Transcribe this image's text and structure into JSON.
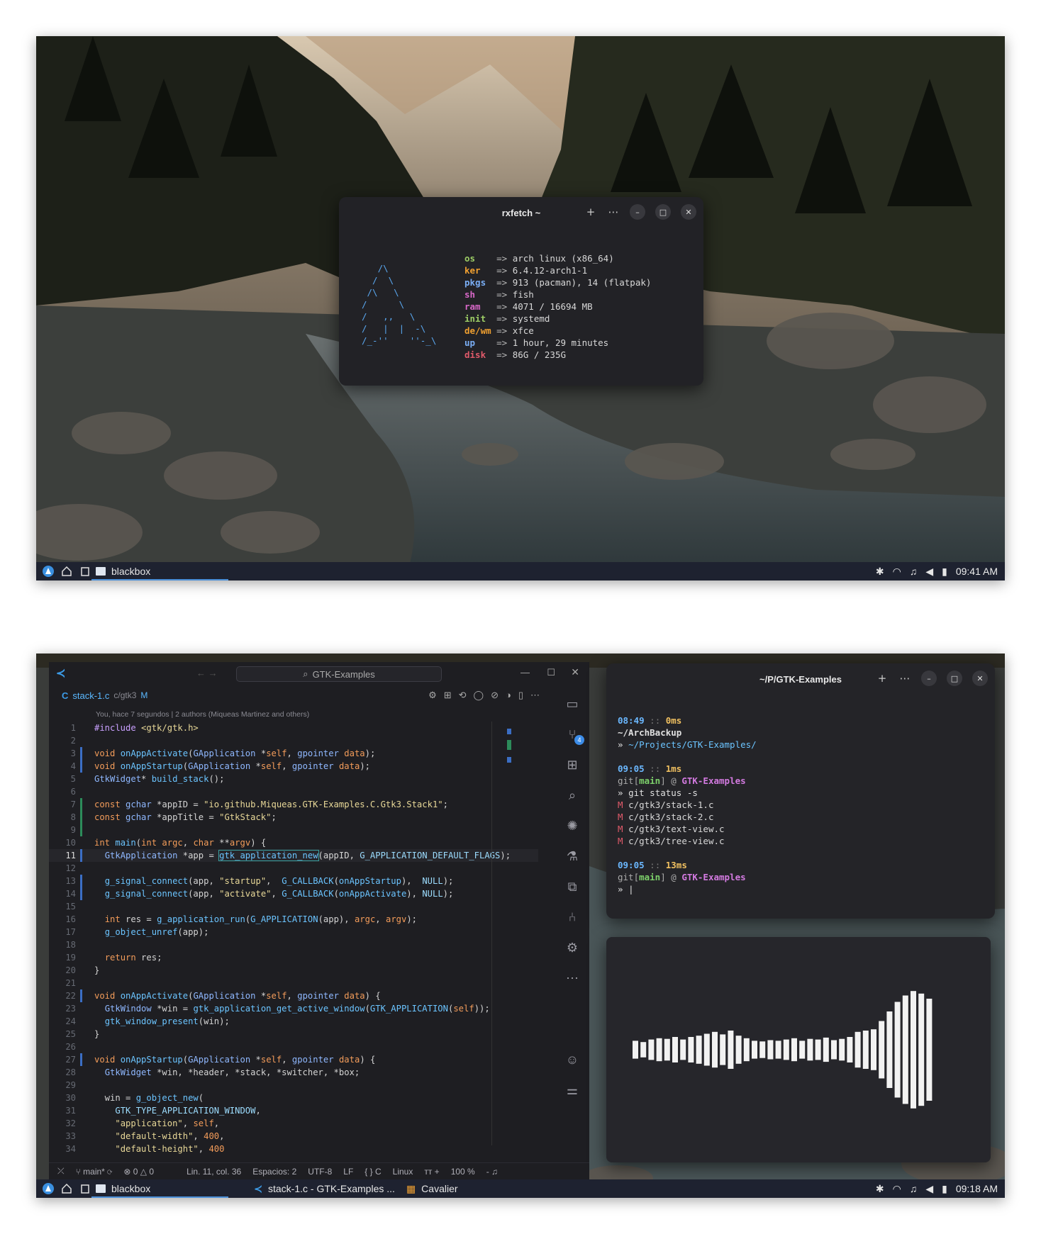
{
  "shot1": {
    "terminal": {
      "title": "rxfetch ~",
      "logo_lines": [
        "   /\\",
        "  /  \\",
        " /\\   \\",
        "/      \\",
        "/   ,,   \\",
        "/   |  |  -\\",
        "/_-''    ''-_\\"
      ],
      "rows": [
        {
          "key": "os",
          "value": "arch linux (x86_64)",
          "color": "#9ccc65"
        },
        {
          "key": "ker",
          "value": "6.4.12-arch1-1",
          "color": "#f0a030"
        },
        {
          "key": "pkgs",
          "value": "913 (pacman), 14 (flatpak)",
          "color": "#7aaef5"
        },
        {
          "key": "sh",
          "value": "fish",
          "color": "#d868c8"
        },
        {
          "key": "ram",
          "value": "4071 / 16694 MB",
          "color": "#d868c8"
        },
        {
          "key": "init",
          "value": "systemd",
          "color": "#9ccc65"
        },
        {
          "key": "de/wm",
          "value": "xfce",
          "color": "#f0a030"
        },
        {
          "key": "up",
          "value": "1 hour, 29 minutes",
          "color": "#7aaef5"
        },
        {
          "key": "disk",
          "value": "86G / 235G",
          "color": "#e05a6a"
        }
      ],
      "arrow": "=>"
    },
    "taskbar": {
      "task": "blackbox",
      "clock": "09:41 AM"
    }
  },
  "shot2": {
    "editor": {
      "search": "GTK-Examples",
      "tab_file": "stack-1.c",
      "tab_path": "c/gtk3",
      "tab_status": "M",
      "blame": "You, hace 7 segundos | 2 authors (Miqueas Martinez and others)",
      "lines": [
        {
          "n": "1",
          "g": "",
          "html": "<span class='p'>#include</span> <span class='s'>&lt;gtk/gtk.h&gt;</span>"
        },
        {
          "n": "2",
          "g": "",
          "html": ""
        },
        {
          "n": "3",
          "g": "b",
          "html": "<span class='k'>void</span> <span class='f'>onAppActivate</span>(<span class='t'>GApplication</span> *<span class='m'>self</span>, <span class='t'>gpointer</span> <span class='m'>data</span>);"
        },
        {
          "n": "4",
          "g": "b",
          "html": "<span class='k'>void</span> <span class='f'>onAppStartup</span>(<span class='t'>GApplication</span> *<span class='m'>self</span>, <span class='t'>gpointer</span> <span class='m'>data</span>);"
        },
        {
          "n": "5",
          "g": "",
          "html": "<span class='t'>GtkWidget</span>* <span class='f'>build_stack</span>();"
        },
        {
          "n": "6",
          "g": "",
          "html": ""
        },
        {
          "n": "7",
          "g": "g",
          "html": "<span class='k'>const</span> <span class='t'>gchar</span> *appID = <span class='s'>\"io.github.Miqueas.GTK-Examples.C.Gtk3.Stack1\"</span>;"
        },
        {
          "n": "8",
          "g": "g",
          "html": "<span class='k'>const</span> <span class='t'>gchar</span> *appTitle = <span class='s'>\"GtkStack\"</span>;"
        },
        {
          "n": "9",
          "g": "g",
          "html": ""
        },
        {
          "n": "10",
          "g": "",
          "html": "<span class='k'>int</span> <span class='f'>main</span>(<span class='k'>int</span> <span class='m'>argc</span>, <span class='k'>char</span> **<span class='m'>argv</span>) {"
        },
        {
          "n": "11",
          "g": "b",
          "html": "  <span class='t'>GtkApplication</span> *app = <span class='f' style='outline:1px solid #3aa0a0'>gtk_application_new</span>(appID, <span class='d'>G_APPLICATION_DEFAULT_FLAGS</span>);"
        },
        {
          "n": "12",
          "g": "",
          "html": ""
        },
        {
          "n": "13",
          "g": "b",
          "html": "  <span class='f'>g_signal_connect</span>(app, <span class='s'>\"startup\"</span>,  <span class='f'>G_CALLBACK</span>(<span class='f'>onAppStartup</span>),  <span class='d'>NULL</span>);"
        },
        {
          "n": "14",
          "g": "b",
          "html": "  <span class='f'>g_signal_connect</span>(app, <span class='s'>\"activate\"</span>, <span class='f'>G_CALLBACK</span>(<span class='f'>onAppActivate</span>), <span class='d'>NULL</span>);"
        },
        {
          "n": "15",
          "g": "",
          "html": ""
        },
        {
          "n": "16",
          "g": "",
          "html": "  <span class='k'>int</span> res = <span class='f'>g_application_run</span>(<span class='f'>G_APPLICATION</span>(app), <span class='m'>argc</span>, <span class='m'>argv</span>);"
        },
        {
          "n": "17",
          "g": "",
          "html": "  <span class='f'>g_object_unref</span>(app);"
        },
        {
          "n": "18",
          "g": "",
          "html": ""
        },
        {
          "n": "19",
          "g": "",
          "html": "  <span class='k'>return</span> res;"
        },
        {
          "n": "20",
          "g": "",
          "html": "}"
        },
        {
          "n": "21",
          "g": "",
          "html": ""
        },
        {
          "n": "22",
          "g": "b",
          "html": "<span class='k'>void</span> <span class='f'>onAppActivate</span>(<span class='t'>GApplication</span> *<span class='m'>self</span>, <span class='t'>gpointer</span> <span class='m'>data</span>) {"
        },
        {
          "n": "23",
          "g": "",
          "html": "  <span class='t'>GtkWindow</span> *win = <span class='f'>gtk_application_get_active_window</span>(<span class='f'>GTK_APPLICATION</span>(<span class='m'>self</span>));"
        },
        {
          "n": "24",
          "g": "",
          "html": "  <span class='f'>gtk_window_present</span>(win);"
        },
        {
          "n": "25",
          "g": "",
          "html": "}"
        },
        {
          "n": "26",
          "g": "",
          "html": ""
        },
        {
          "n": "27",
          "g": "b",
          "html": "<span class='k'>void</span> <span class='f'>onAppStartup</span>(<span class='t'>GApplication</span> *<span class='m'>self</span>, <span class='t'>gpointer</span> <span class='m'>data</span>) {"
        },
        {
          "n": "28",
          "g": "",
          "html": "  <span class='t'>GtkWidget</span> *win, *header, *stack, *switcher, *box;"
        },
        {
          "n": "29",
          "g": "",
          "html": ""
        },
        {
          "n": "30",
          "g": "",
          "html": "  win = <span class='f'>g_object_new</span>("
        },
        {
          "n": "31",
          "g": "",
          "html": "    <span class='d'>GTK_TYPE_APPLICATION_WINDOW</span>,"
        },
        {
          "n": "32",
          "g": "",
          "html": "    <span class='s'>\"application\"</span>, <span class='m'>self</span>,"
        },
        {
          "n": "33",
          "g": "",
          "html": "    <span class='s'>\"default-width\"</span>, <span class='m'>400</span>,"
        },
        {
          "n": "34",
          "g": "",
          "html": "    <span class='s'>\"default-height\"</span>, <span class='m'>400</span>"
        }
      ],
      "scm_badge": "4",
      "status": {
        "branch": "main*",
        "problems": "0",
        "warnings": "0",
        "position": "Lin. 11, col. 36",
        "spaces": "Espacios: 2",
        "encoding": "UTF-8",
        "eol": "LF",
        "language": "C",
        "os": "Linux",
        "zoom": "100 %"
      }
    },
    "terminal": {
      "title": "~/P/GTK-Examples",
      "blocks": [
        {
          "time": "08:49",
          "dur": "0ms",
          "lines": [
            "~/ArchBackup",
            "» ~/Projects/GTK-Examples/"
          ]
        },
        {
          "time": "09:05",
          "dur": "1ms"
        },
        {
          "time": "09:05",
          "dur": "13ms"
        }
      ],
      "git_branch": "main",
      "repo": "GTK-Examples",
      "cmd": "git status -s",
      "changed": [
        "c/gtk3/stack-1.c",
        "c/gtk3/stack-2.c",
        "c/gtk3/text-view.c",
        "c/gtk3/tree-view.c"
      ]
    },
    "visualizer": {
      "bars": [
        0.14,
        0.12,
        0.16,
        0.18,
        0.17,
        0.2,
        0.16,
        0.2,
        0.22,
        0.25,
        0.28,
        0.24,
        0.3,
        0.22,
        0.18,
        0.14,
        0.13,
        0.15,
        0.14,
        0.16,
        0.18,
        0.14,
        0.17,
        0.16,
        0.19,
        0.15,
        0.17,
        0.2,
        0.28,
        0.3,
        0.32,
        0.45,
        0.6,
        0.75,
        0.85,
        0.92,
        0.88,
        0.8
      ]
    },
    "taskbar": {
      "task1": "blackbox",
      "task2": "stack-1.c - GTK-Examples ...",
      "task3": "Cavalier",
      "clock": "09:18 AM"
    }
  }
}
